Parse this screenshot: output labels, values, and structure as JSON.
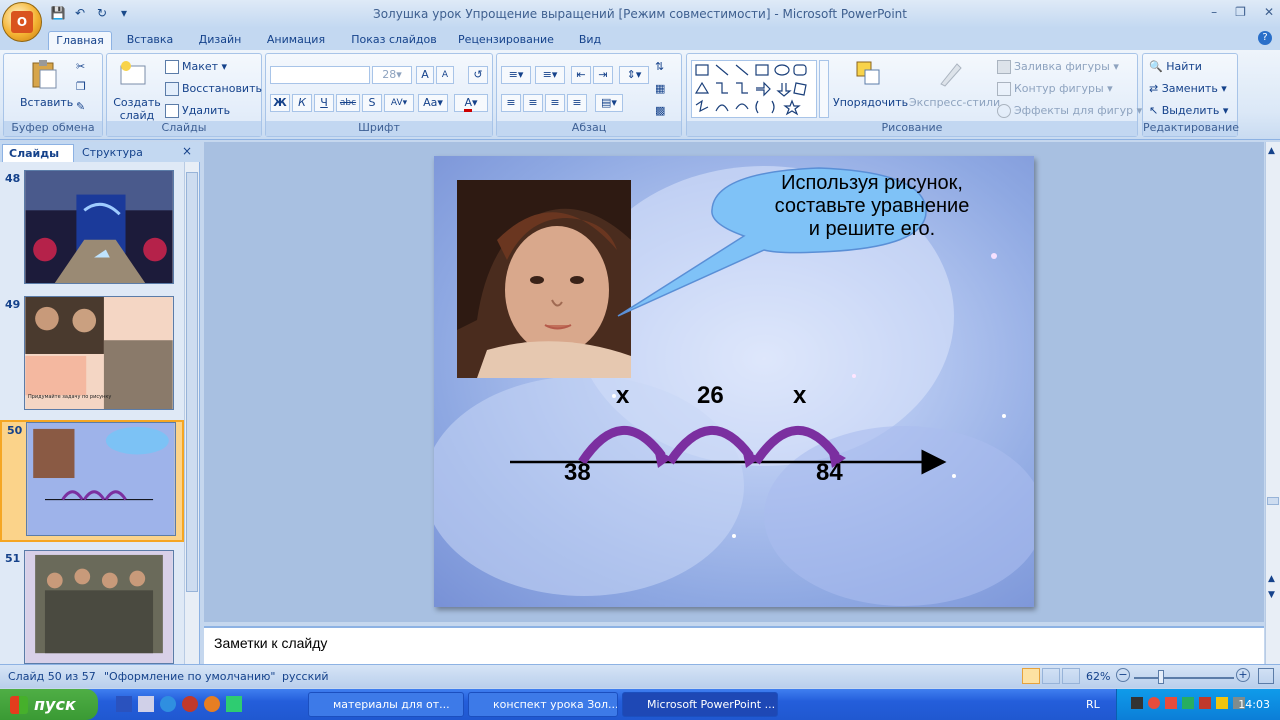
{
  "window": {
    "title": "Золушка урок Упрощение выращений [Режим совместимости] - Microsoft PowerPoint"
  },
  "ribbon_tabs": [
    "Главная",
    "Вставка",
    "Дизайн",
    "Анимация",
    "Показ слайдов",
    "Рецензирование",
    "Вид"
  ],
  "active_tab": "Главная",
  "clipboard": {
    "paste": "Вставить",
    "group": "Буфер обмена"
  },
  "slides_group": {
    "new_slide": "Создать слайд",
    "layout": "Макет",
    "reset": "Восстановить",
    "delete": "Удалить",
    "group": "Слайды"
  },
  "font_group": {
    "font_size": "28",
    "group": "Шрифт"
  },
  "paragraph_group": {
    "group": "Абзац"
  },
  "drawing_group": {
    "arrange": "Упорядочить",
    "quick_styles": "Экспресс-стили",
    "fill": "Заливка фигуры",
    "outline": "Контур фигуры",
    "effects": "Эффекты для фигур",
    "group": "Рисование"
  },
  "editing_group": {
    "find": "Найти",
    "replace": "Заменить",
    "select": "Выделить",
    "group": "Редактирование"
  },
  "pane_tabs": {
    "slides": "Слайды",
    "outline": "Структура"
  },
  "thumbnails": [
    {
      "num": "48"
    },
    {
      "num": "49",
      "caption": "Придумайте задачу по рисунку"
    },
    {
      "num": "50"
    },
    {
      "num": "51"
    }
  ],
  "slide": {
    "callout": "Используя рисунок,\nсоставьте  уравнение\nи решите его.",
    "arc_labels": [
      "x",
      "26",
      "x"
    ],
    "start": "38",
    "end": "84"
  },
  "notes": {
    "placeholder": "Заметки к слайду"
  },
  "status": {
    "slide_info": "Слайд 50 из 57",
    "theme": "\"Оформление по умолчанию\"",
    "language": "русский",
    "zoom": "62%"
  },
  "taskbar": {
    "start": "пуск",
    "buttons": [
      "материалы для от...",
      "конспект урока Зол...",
      "Microsoft PowerPoint ..."
    ],
    "lang": "RL",
    "clock": "14:03"
  },
  "colors": {
    "accent": "#15428b",
    "arc": "#7b2fa0",
    "slide_bg": "#8ea8e2"
  }
}
